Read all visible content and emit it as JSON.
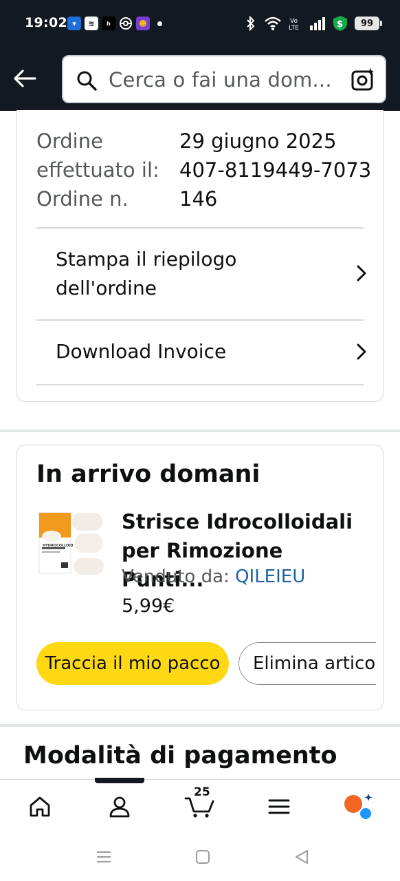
{
  "status_bar": {
    "time": "19:02",
    "battery": "99",
    "app_icons": [
      "app-icon-1",
      "app-icon-2",
      "app-icon-3",
      "app-icon-4",
      "app-icon-5"
    ],
    "system_icons": [
      "bluetooth-icon",
      "wifi-icon",
      "volte-icon",
      "signal-icon",
      "shield-dollar-icon"
    ]
  },
  "header": {
    "search_placeholder": "Cerca o fai una dom..."
  },
  "order_info": {
    "date_label": "Ordine effettuato il:",
    "date_value": "29 giugno 2025",
    "number_label": "Ordine n.",
    "number_value": "407-8119449-7073146",
    "print_summary_label": "Stampa il riepilogo dell'ordine",
    "download_invoice_label": "Download Invoice"
  },
  "delivery": {
    "title": "In arrivo domani",
    "product_title": "Strisce Idrocolloidali per Rimozione Punti...",
    "sold_by_label": "Venduto da:",
    "seller": "QILEIEU",
    "price": "5,99€",
    "track_button": "Traccia il mio pacco",
    "remove_button": "Elimina artico",
    "thumb_label": "HYDROCOLLOID",
    "accent_color": "#ffd814",
    "link_color": "#2162a1"
  },
  "payment": {
    "title": "Modalità di pagamento"
  },
  "bottom_nav": {
    "cart_count": "25",
    "items": [
      "home-icon",
      "account-icon",
      "cart-icon",
      "menu-icon",
      "rufus-ai-icon"
    ]
  },
  "colors": {
    "header_bg": "#131921",
    "text": "#0f1111",
    "muted_text": "#565959",
    "border": "#d5d9d9"
  }
}
